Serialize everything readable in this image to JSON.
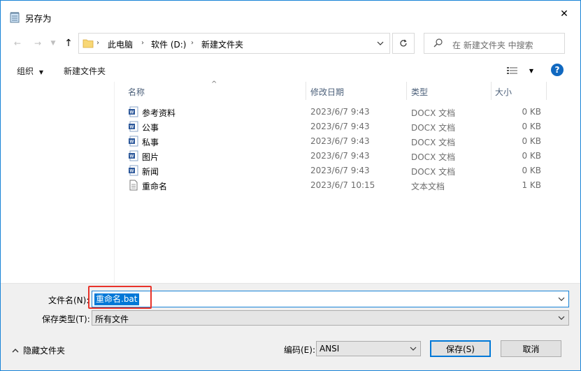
{
  "window": {
    "title": "另存为",
    "close_glyph": "✕"
  },
  "nav": {
    "back_glyph": "←",
    "forward_glyph": "→",
    "up_glyph": "↑",
    "breadcrumbs": [
      "此电脑",
      "软件 (D:)",
      "新建文件夹"
    ],
    "search_placeholder": "在 新建文件夹 中搜索"
  },
  "toolbar": {
    "organize_label": "组织",
    "new_folder_label": "新建文件夹",
    "help_label": "?"
  },
  "columns": {
    "name": "名称",
    "date": "修改日期",
    "type": "类型",
    "size": "大小"
  },
  "files": [
    {
      "name": "参考资料",
      "date": "2023/6/7 9:43",
      "type": "DOCX 文档",
      "size": "0 KB",
      "icon": "word-doc-icon"
    },
    {
      "name": "公事",
      "date": "2023/6/7 9:43",
      "type": "DOCX 文档",
      "size": "0 KB",
      "icon": "word-doc-icon"
    },
    {
      "name": "私事",
      "date": "2023/6/7 9:43",
      "type": "DOCX 文档",
      "size": "0 KB",
      "icon": "word-doc-icon"
    },
    {
      "name": "图片",
      "date": "2023/6/7 9:43",
      "type": "DOCX 文档",
      "size": "0 KB",
      "icon": "word-doc-icon"
    },
    {
      "name": "新闻",
      "date": "2023/6/7 9:43",
      "type": "DOCX 文档",
      "size": "0 KB",
      "icon": "word-doc-icon"
    },
    {
      "name": "重命名",
      "date": "2023/6/7 10:15",
      "type": "文本文档",
      "size": "1 KB",
      "icon": "text-doc-icon"
    }
  ],
  "save": {
    "filename_label": "文件名(N):",
    "filename_value": "重命名.bat",
    "filetype_label": "保存类型(T):",
    "filetype_value": "所有文件",
    "hide_folders_label": "隐藏文件夹",
    "encoding_label": "编码(E):",
    "encoding_value": "ANSI",
    "save_label": "保存(S)",
    "cancel_label": "取消"
  },
  "colors": {
    "accent": "#0078d7",
    "highlight_box": "#e8332a",
    "word_icon": "#2b579a",
    "folder": "#f8d775"
  }
}
